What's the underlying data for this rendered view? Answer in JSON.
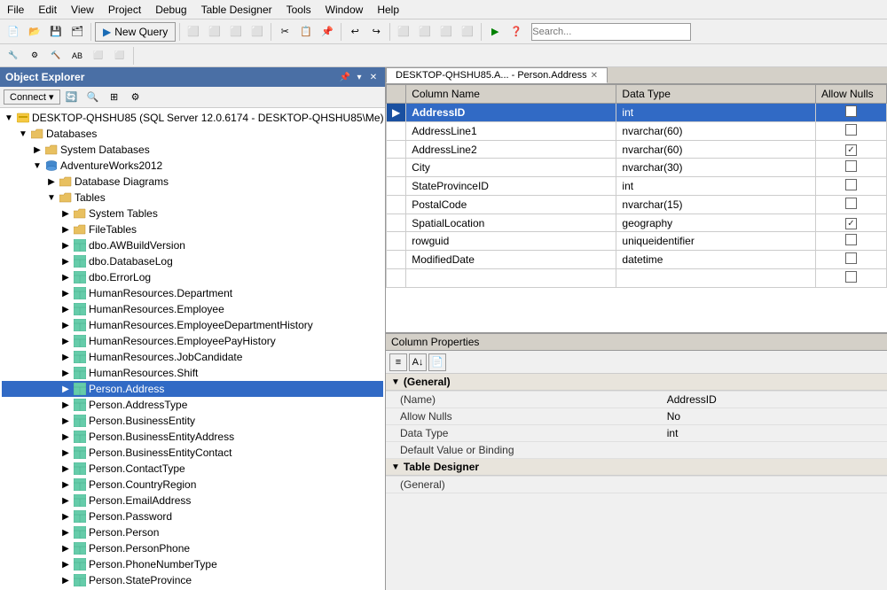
{
  "menubar": {
    "items": [
      "File",
      "Edit",
      "View",
      "Project",
      "Debug",
      "Table Designer",
      "Tools",
      "Window",
      "Help"
    ]
  },
  "toolbar": {
    "new_query_label": "New Query"
  },
  "object_explorer": {
    "title": "Object Explorer",
    "connect_label": "Connect ▾",
    "server": "DESKTOP-QHSHU85 (SQL Server 12.0.6174 - DESKTOP-QHSHU85\\Me)",
    "tree_items": [
      {
        "id": "server",
        "label": "DESKTOP-QHSHU85 (SQL Server 12.0.6174 - DESKTOP-QHSHU85\\Me)",
        "level": 0,
        "expanded": true,
        "type": "server"
      },
      {
        "id": "databases",
        "label": "Databases",
        "level": 1,
        "expanded": true,
        "type": "folder"
      },
      {
        "id": "systemdbs",
        "label": "System Databases",
        "level": 2,
        "expanded": false,
        "type": "folder"
      },
      {
        "id": "adventureworks",
        "label": "AdventureWorks2012",
        "level": 2,
        "expanded": true,
        "type": "db"
      },
      {
        "id": "dbdiagrams",
        "label": "Database Diagrams",
        "level": 3,
        "expanded": false,
        "type": "folder"
      },
      {
        "id": "tables",
        "label": "Tables",
        "level": 3,
        "expanded": true,
        "type": "folder"
      },
      {
        "id": "systables",
        "label": "System Tables",
        "level": 4,
        "expanded": false,
        "type": "folder"
      },
      {
        "id": "filetables",
        "label": "FileTables",
        "level": 4,
        "expanded": false,
        "type": "folder"
      },
      {
        "id": "t1",
        "label": "dbo.AWBuildVersion",
        "level": 4,
        "expanded": false,
        "type": "table"
      },
      {
        "id": "t2",
        "label": "dbo.DatabaseLog",
        "level": 4,
        "expanded": false,
        "type": "table"
      },
      {
        "id": "t3",
        "label": "dbo.ErrorLog",
        "level": 4,
        "expanded": false,
        "type": "table"
      },
      {
        "id": "t4",
        "label": "HumanResources.Department",
        "level": 4,
        "expanded": false,
        "type": "table"
      },
      {
        "id": "t5",
        "label": "HumanResources.Employee",
        "level": 4,
        "expanded": false,
        "type": "table"
      },
      {
        "id": "t6",
        "label": "HumanResources.EmployeeDepartmentHistory",
        "level": 4,
        "expanded": false,
        "type": "table"
      },
      {
        "id": "t7",
        "label": "HumanResources.EmployeePayHistory",
        "level": 4,
        "expanded": false,
        "type": "table"
      },
      {
        "id": "t8",
        "label": "HumanResources.JobCandidate",
        "level": 4,
        "expanded": false,
        "type": "table"
      },
      {
        "id": "t9",
        "label": "HumanResources.Shift",
        "level": 4,
        "expanded": false,
        "type": "table"
      },
      {
        "id": "t10",
        "label": "Person.Address",
        "level": 4,
        "expanded": false,
        "type": "table",
        "selected": true
      },
      {
        "id": "t11",
        "label": "Person.AddressType",
        "level": 4,
        "expanded": false,
        "type": "table"
      },
      {
        "id": "t12",
        "label": "Person.BusinessEntity",
        "level": 4,
        "expanded": false,
        "type": "table"
      },
      {
        "id": "t13",
        "label": "Person.BusinessEntityAddress",
        "level": 4,
        "expanded": false,
        "type": "table"
      },
      {
        "id": "t14",
        "label": "Person.BusinessEntityContact",
        "level": 4,
        "expanded": false,
        "type": "table"
      },
      {
        "id": "t15",
        "label": "Person.ContactType",
        "level": 4,
        "expanded": false,
        "type": "table"
      },
      {
        "id": "t16",
        "label": "Person.CountryRegion",
        "level": 4,
        "expanded": false,
        "type": "table"
      },
      {
        "id": "t17",
        "label": "Person.EmailAddress",
        "level": 4,
        "expanded": false,
        "type": "table"
      },
      {
        "id": "t18",
        "label": "Person.Password",
        "level": 4,
        "expanded": false,
        "type": "table"
      },
      {
        "id": "t19",
        "label": "Person.Person",
        "level": 4,
        "expanded": false,
        "type": "table"
      },
      {
        "id": "t20",
        "label": "Person.PersonPhone",
        "level": 4,
        "expanded": false,
        "type": "table"
      },
      {
        "id": "t21",
        "label": "Person.PhoneNumberType",
        "level": 4,
        "expanded": false,
        "type": "table"
      },
      {
        "id": "t22",
        "label": "Person.StateProvince",
        "level": 4,
        "expanded": false,
        "type": "table"
      }
    ]
  },
  "designer": {
    "tab_label": "DESKTOP-QHSHU85.A... - Person.Address",
    "columns_header": [
      "",
      "Column Name",
      "Data Type",
      "Allow Nulls"
    ],
    "columns": [
      {
        "name": "AddressID",
        "datatype": "int",
        "allow_nulls": false,
        "selected": true
      },
      {
        "name": "AddressLine1",
        "datatype": "nvarchar(60)",
        "allow_nulls": false
      },
      {
        "name": "AddressLine2",
        "datatype": "nvarchar(60)",
        "allow_nulls": true
      },
      {
        "name": "City",
        "datatype": "nvarchar(30)",
        "allow_nulls": false
      },
      {
        "name": "StateProvinceID",
        "datatype": "int",
        "allow_nulls": false
      },
      {
        "name": "PostalCode",
        "datatype": "nvarchar(15)",
        "allow_nulls": false
      },
      {
        "name": "SpatialLocation",
        "datatype": "geography",
        "allow_nulls": true
      },
      {
        "name": "rowguid",
        "datatype": "uniqueidentifier",
        "allow_nulls": false
      },
      {
        "name": "ModifiedDate",
        "datatype": "datetime",
        "allow_nulls": false
      },
      {
        "name": "",
        "datatype": "",
        "allow_nulls": false
      }
    ]
  },
  "column_properties": {
    "tab_label": "Column Properties",
    "general_section": "(General)",
    "general_section2": "(General)",
    "properties": [
      {
        "name": "(Name)",
        "value": "AddressID"
      },
      {
        "name": "Allow Nulls",
        "value": "No"
      },
      {
        "name": "Data Type",
        "value": "int"
      },
      {
        "name": "Default Value or Binding",
        "value": ""
      }
    ],
    "table_designer_section": "Table Designer"
  }
}
